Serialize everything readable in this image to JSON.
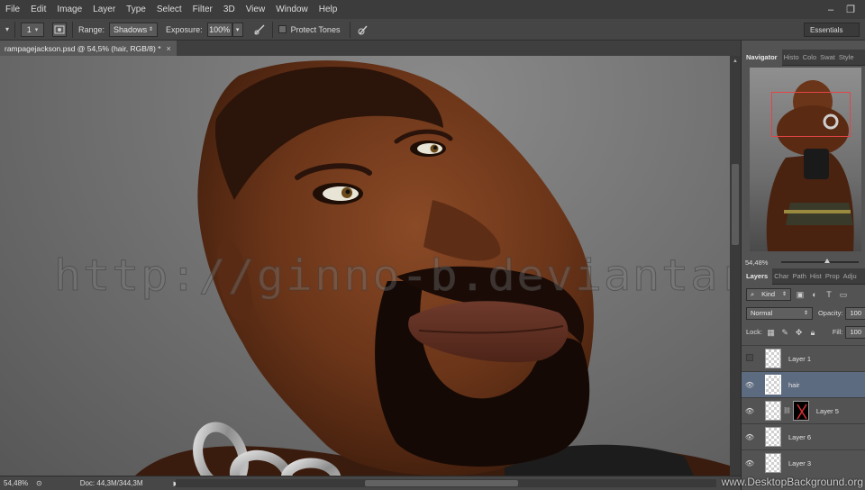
{
  "menubar": {
    "items": [
      "File",
      "Edit",
      "Image",
      "Layer",
      "Type",
      "Select",
      "Filter",
      "3D",
      "View",
      "Window",
      "Help"
    ]
  },
  "options_bar": {
    "brush_size": "1",
    "range_label": "Range:",
    "range_value": "Shadows",
    "exposure_label": "Exposure:",
    "exposure_value": "100%",
    "protect_tones_label": "Protect Tones",
    "protect_tones_checked": false,
    "workspace": "Essentials"
  },
  "document": {
    "tab_title": "rampagejackson.psd @ 54,5% (hair, RGB/8) *",
    "close_glyph": "×",
    "watermark": "http://ginno-b.deviantart.com/"
  },
  "status_bar": {
    "zoom": "54,48%",
    "doc_size": "Doc: 44,3M/344,3M"
  },
  "navigator": {
    "tabs": [
      "Navigator",
      "Histo",
      "Colo",
      "Swat",
      "Style"
    ],
    "zoom": "54,48%"
  },
  "layers_panel": {
    "tabs": [
      "Layers",
      "Char",
      "Path",
      "Hist",
      "Prop",
      "Adju"
    ],
    "filter_kind": "Kind",
    "blend_mode": "Normal",
    "opacity_label": "Opacity:",
    "opacity_value": "100",
    "lock_label": "Lock:",
    "fill_label": "Fill:",
    "fill_value": "100",
    "layers": [
      {
        "name": "Layer 1",
        "visible": false,
        "selected": false
      },
      {
        "name": "hair",
        "visible": true,
        "selected": true
      },
      {
        "name": "Layer 5",
        "visible": true,
        "selected": false
      },
      {
        "name": "Layer 6",
        "visible": true,
        "selected": false
      },
      {
        "name": "Layer 3",
        "visible": true,
        "selected": false
      }
    ]
  },
  "corner_watermark": "www.DesktopBackground.org",
  "colors": {
    "menubar_bg": "#3c3c3c",
    "panel_bg": "#535353",
    "selected_layer": "#5d6b80",
    "navigator_rect": "#e24545"
  }
}
